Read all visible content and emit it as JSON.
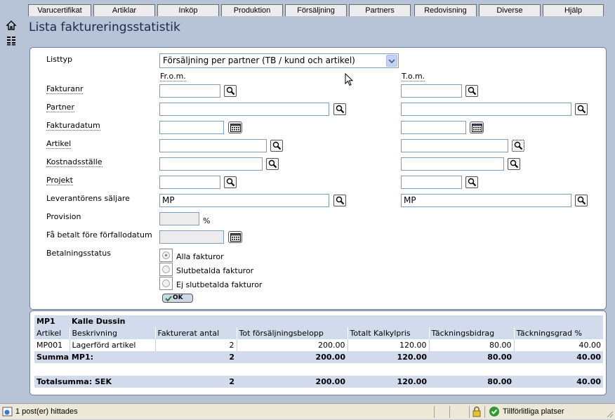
{
  "nav": {
    "tabs": [
      "Varucertifikat",
      "Artiklar",
      "Inköp",
      "Produktion",
      "Försäljning",
      "Partners",
      "Redovisning",
      "Diverse",
      "Hjälp"
    ]
  },
  "page": {
    "title": "Lista faktureringsstatistik"
  },
  "form": {
    "listtyp_label": "Listtyp",
    "listtyp_value": "Försäljning per partner (TB / kund och artikel)",
    "from_header": "Fr.o.m.",
    "to_header": "T.o.m.",
    "fakturanr_label": "Fakturanr",
    "partner_label": "Partner",
    "fakturadatum_label": "Fakturadatum",
    "artikel_label": "Artikel",
    "kostnadsstalle_label": "Kostnadsställe",
    "projekt_label": "Projekt",
    "saljare_label": "Leverantörens säljare",
    "saljare_from_value": "MP",
    "saljare_to_value": "MP",
    "provision_label": "Provision",
    "provision_unit": "%",
    "betalt_label": "Få betalt före förfallodatum",
    "betalningsstatus_label": "Betalningsstatus",
    "radio_options": [
      "Alla fakturor",
      "Slutbetalda fakturor",
      "Ej slutbetalda fakturor"
    ],
    "radio_selected": "Alla fakturor",
    "ok_label": "OK"
  },
  "results": {
    "group_code": "MP1",
    "group_name": "Kalle Dussin",
    "columns": [
      "Artikel",
      "Beskrivning",
      "Fakturerat antal",
      "Tot försäljningsbelopp",
      "Totalt Kalkylpris",
      "Täckningsbidrag",
      "Täckningsgrad %"
    ],
    "rows": [
      [
        "MP001",
        "Lagerförd artikel",
        "2",
        "200.00",
        "120.00",
        "80.00",
        "40.00"
      ]
    ],
    "summa": [
      "Summa  MP1:",
      "",
      "2",
      "200.00",
      "120.00",
      "80.00",
      "40.00"
    ],
    "total": [
      "Totalsumma: SEK",
      "",
      "2",
      "200.00",
      "120.00",
      "80.00",
      "40.00"
    ]
  },
  "statusbar": {
    "status_text": "1 post(er) hittades",
    "zone_text": "Tillförlitliga platser"
  }
}
